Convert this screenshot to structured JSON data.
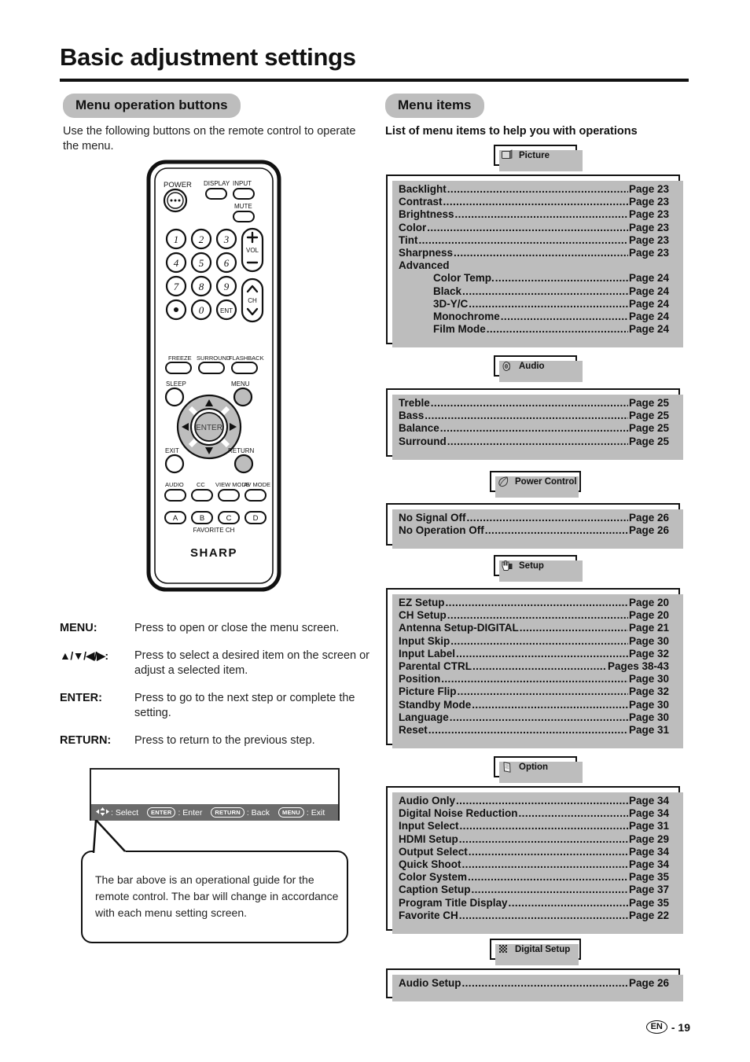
{
  "page": {
    "title": "Basic adjustment settings",
    "footer_locale": "EN",
    "footer_sep": "-",
    "footer_page": "19"
  },
  "left": {
    "pill": "Menu operation buttons",
    "intro": "Use the following buttons on the remote control to operate the menu.",
    "remote": {
      "power": "POWER",
      "display": "DISPLAY",
      "input": "INPUT",
      "mute": "MUTE",
      "keys": [
        "1",
        "2",
        "3",
        "4",
        "5",
        "6",
        "7",
        "8",
        "9",
        "•",
        "0",
        "ENT"
      ],
      "vol": "VOL",
      "ch": "CH",
      "freeze": "FREEZE",
      "surround": "SURROUND",
      "flashback": "FLASHBACK",
      "sleep": "SLEEP",
      "menu": "MENU",
      "enter": "ENTER",
      "exit": "EXIT",
      "return": "RETURN",
      "audio": "AUDIO",
      "cc": "CC",
      "viewmode": "VIEW MODE",
      "avmode": "AV MODE",
      "color_keys": [
        "A",
        "B",
        "C",
        "D"
      ],
      "favorite": "FAVORITE CH",
      "brand": "SHARP"
    },
    "key_descriptions": [
      {
        "label": "MENU:",
        "text": "Press to open or close the menu screen."
      },
      {
        "label": "▲/▼/◀/▶:",
        "text": "Press to select a desired item on the screen or adjust a selected item."
      },
      {
        "label": "ENTER:",
        "text": "Press to go to the next step or complete the setting."
      },
      {
        "label": "RETURN:",
        "text": "Press to return to the previous step."
      }
    ],
    "osd_guide": {
      "segments": [
        {
          "key": "",
          "icon": "dpad-cross-icon",
          "text": ": Select"
        },
        {
          "key": "ENTER",
          "icon": "",
          "text": ": Enter"
        },
        {
          "key": "RETURN",
          "icon": "",
          "text": ": Back"
        },
        {
          "key": "MENU",
          "icon": "",
          "text": ": Exit"
        }
      ]
    },
    "callout": "The bar above is an operational guide for the remote control. The bar will change in accordance with each menu setting screen."
  },
  "right": {
    "pill": "Menu items",
    "subtitle": "List of menu items to help you with operations",
    "sections": [
      {
        "name": "Picture",
        "icon": "picture-monitor-icon",
        "items": [
          {
            "label": "Backlight",
            "page": "Page 23",
            "indent": false
          },
          {
            "label": "Contrast",
            "page": "Page 23",
            "indent": false
          },
          {
            "label": "Brightness",
            "page": "Page 23",
            "indent": false
          },
          {
            "label": "Color",
            "page": "Page 23",
            "indent": false
          },
          {
            "label": "Tint",
            "page": "Page 23",
            "indent": false
          },
          {
            "label": "Sharpness",
            "page": "Page 23",
            "indent": false
          },
          {
            "label": "Advanced",
            "page": "",
            "indent": false,
            "nodots": true
          },
          {
            "label": "Color Temp.",
            "page": "Page 24",
            "indent": true
          },
          {
            "label": "Black",
            "page": "Page 24",
            "indent": true
          },
          {
            "label": "3D-Y/C",
            "page": "Page 24",
            "indent": true
          },
          {
            "label": "Monochrome",
            "page": "Page 24",
            "indent": true
          },
          {
            "label": "Film Mode",
            "page": "Page 24",
            "indent": true
          }
        ]
      },
      {
        "name": "Audio",
        "icon": "speaker-icon",
        "items": [
          {
            "label": "Treble",
            "page": "Page 25",
            "indent": false
          },
          {
            "label": "Bass",
            "page": "Page 25",
            "indent": false
          },
          {
            "label": "Balance",
            "page": "Page 25",
            "indent": false
          },
          {
            "label": "Surround",
            "page": "Page 25",
            "indent": false
          }
        ]
      },
      {
        "name": "Power Control",
        "icon": "leaf-icon",
        "items": [
          {
            "label": "No Signal Off",
            "page": "Page 26",
            "indent": false
          },
          {
            "label": "No Operation Off",
            "page": "Page 26",
            "indent": false
          }
        ]
      },
      {
        "name": "Setup",
        "icon": "hand-pointer-icon",
        "items": [
          {
            "label": "EZ Setup",
            "page": "Page 20",
            "indent": false
          },
          {
            "label": "CH Setup",
            "page": "Page 20",
            "indent": false
          },
          {
            "label": "Antenna Setup-DIGITAL",
            "page": "Page 21",
            "indent": false
          },
          {
            "label": "Input Skip",
            "page": "Page 30",
            "indent": false
          },
          {
            "label": "Input Label",
            "page": "Page 32",
            "indent": false
          },
          {
            "label": "Parental CTRL",
            "page": "Pages 38-43",
            "indent": false
          },
          {
            "label": "Position",
            "page": "Page 30",
            "indent": false
          },
          {
            "label": "Picture Flip",
            "page": "Page 32",
            "indent": false
          },
          {
            "label": "Standby Mode",
            "page": "Page 30",
            "indent": false
          },
          {
            "label": "Language",
            "page": "Page 30",
            "indent": false
          },
          {
            "label": "Reset",
            "page": "Page 31",
            "indent": false
          }
        ]
      },
      {
        "name": "Option",
        "icon": "document-icon",
        "items": [
          {
            "label": "Audio Only",
            "page": "Page 34",
            "indent": false
          },
          {
            "label": "Digital Noise Reduction",
            "page": "Page 34",
            "indent": false
          },
          {
            "label": "Input Select",
            "page": "Page 31",
            "indent": false
          },
          {
            "label": "HDMI Setup",
            "page": "Page 29",
            "indent": false
          },
          {
            "label": "Output Select",
            "page": "Page 34",
            "indent": false
          },
          {
            "label": "Quick Shoot",
            "page": "Page 34",
            "indent": false
          },
          {
            "label": "Color System",
            "page": "Page 35",
            "indent": false
          },
          {
            "label": "Caption Setup",
            "page": "Page 37",
            "indent": false
          },
          {
            "label": "Program Title Display",
            "page": "Page 35",
            "indent": false
          },
          {
            "label": "Favorite CH",
            "page": "Page 22",
            "indent": false
          }
        ]
      },
      {
        "name": "Digital Setup",
        "icon": "pixel-grid-icon",
        "items": [
          {
            "label": "Audio Setup",
            "page": "Page 26",
            "indent": false
          }
        ]
      }
    ]
  },
  "colors": {
    "pill_bg": "#bdbdbd",
    "shadow": "#bdbdbd",
    "osd_bar": "#6b6b6b",
    "ink": "#111111"
  }
}
